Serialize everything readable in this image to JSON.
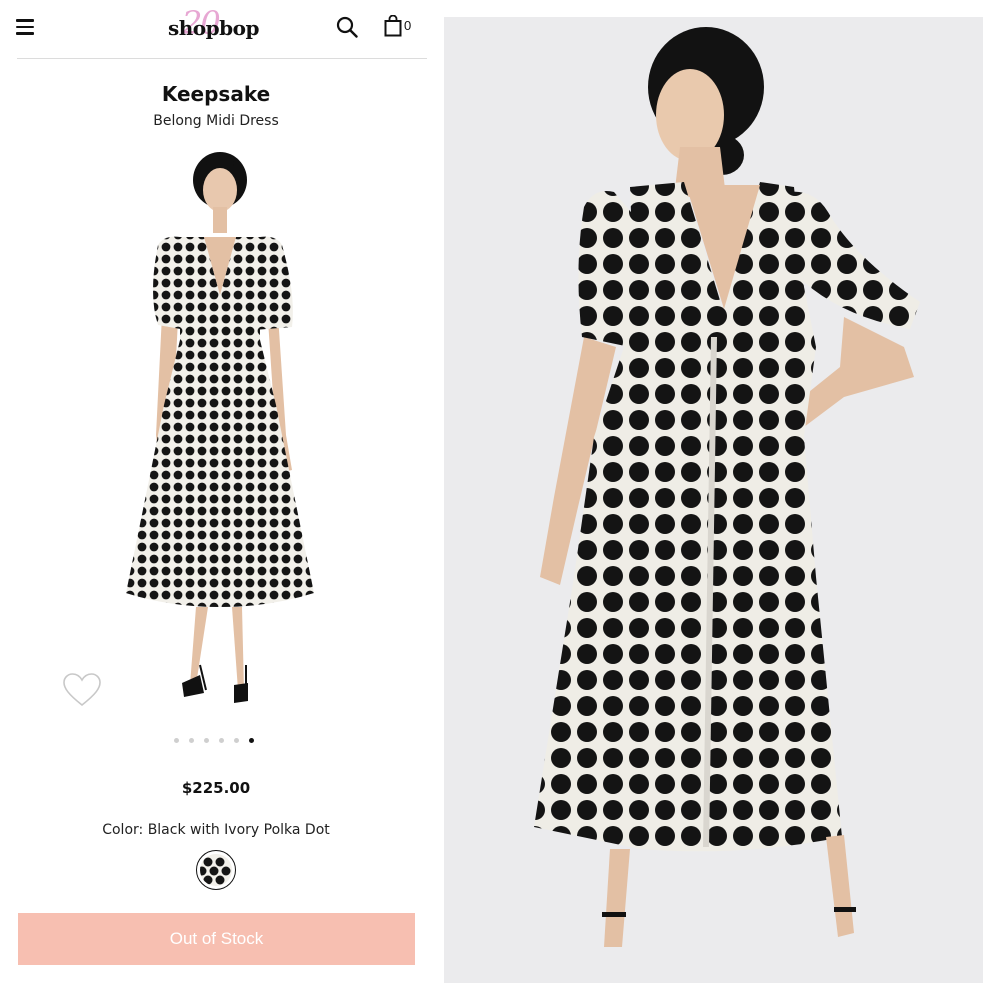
{
  "header": {
    "logo_text": "shopbop",
    "logo_number": "20",
    "bag_count": "0",
    "icons": [
      "menu-icon",
      "search-icon",
      "shopping-bag-icon"
    ]
  },
  "product": {
    "brand": "Keepsake",
    "name": "Belong Midi Dress",
    "price": "$225.00",
    "color_label": "Color: Black with Ivory Polka Dot",
    "button_label": "Out of Stock",
    "carousel_total": 6,
    "carousel_active": 6
  },
  "colors": {
    "logo_accent": "#e7a7d3",
    "button_bg": "#f7bfb1",
    "dress_black": "#111111",
    "dot_ivory": "#f2f0ea"
  }
}
